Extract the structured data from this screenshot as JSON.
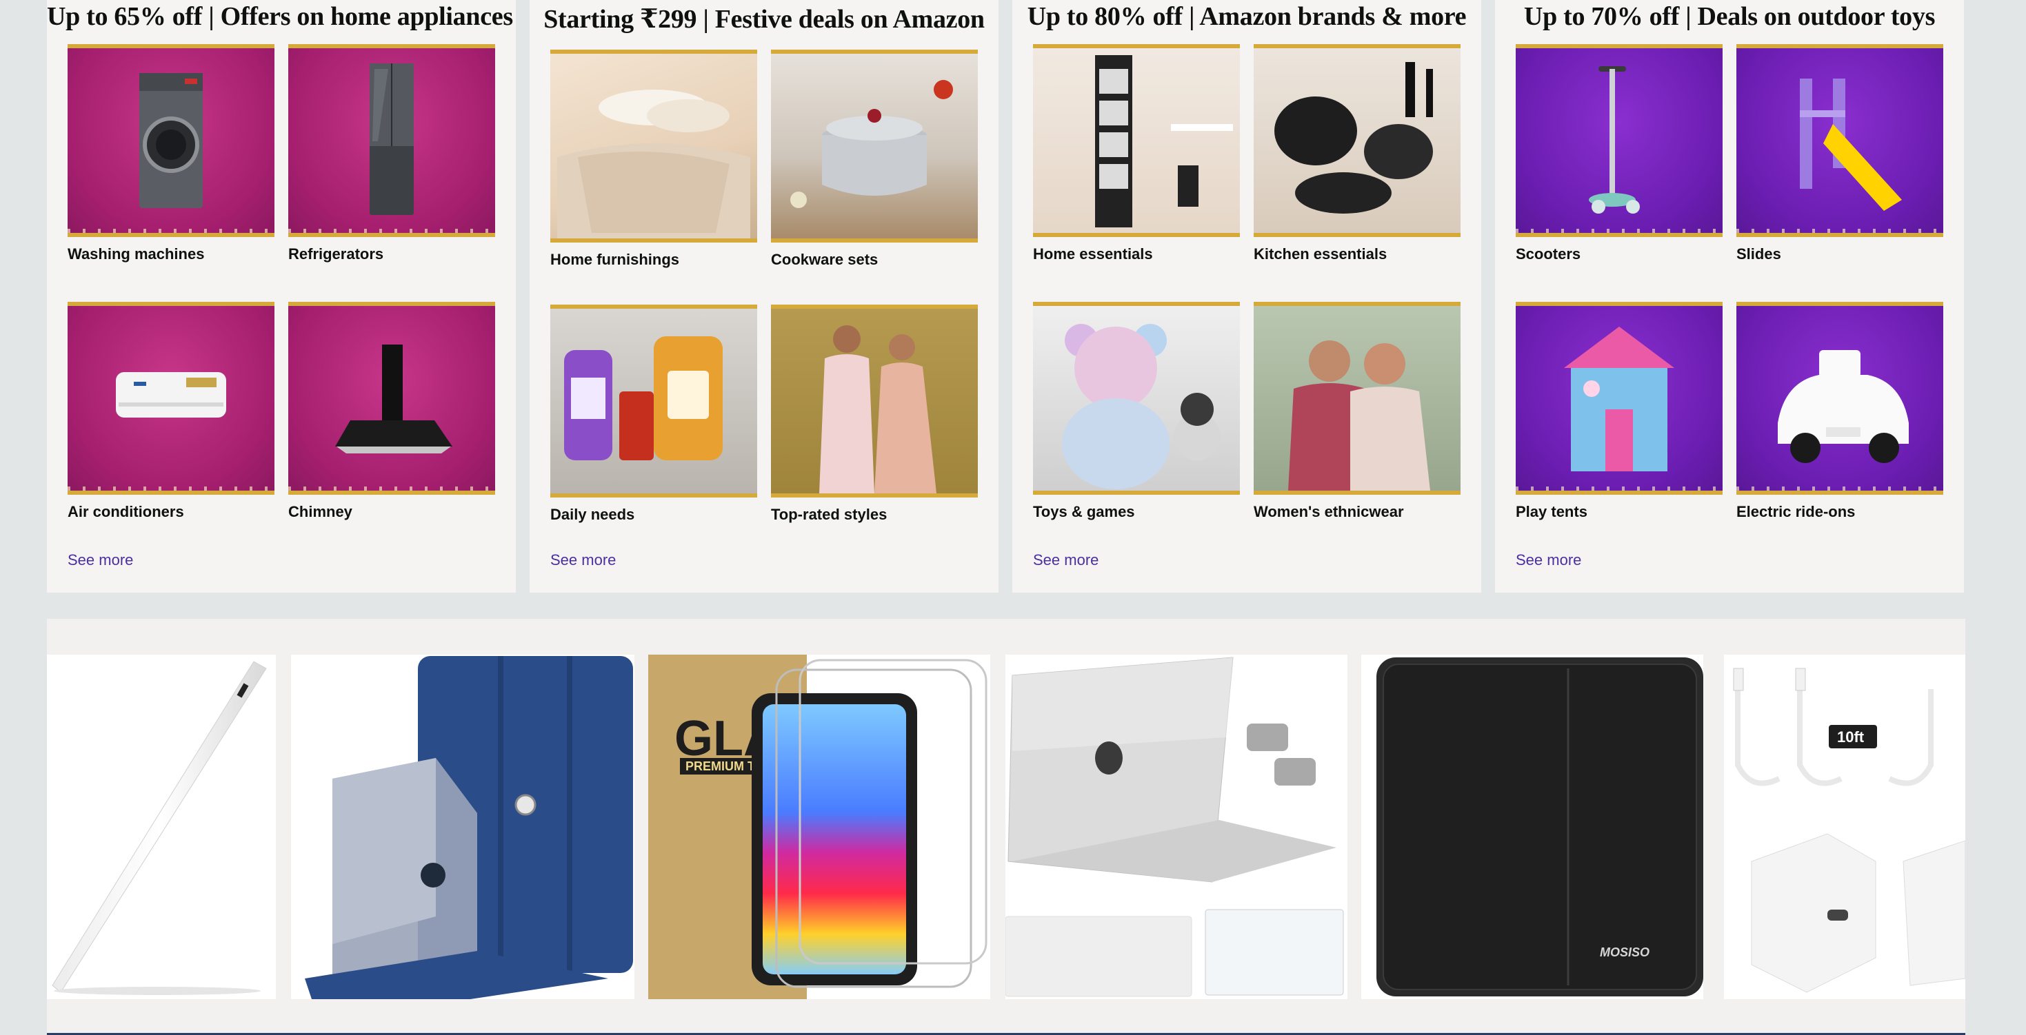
{
  "cards": [
    {
      "title": "Up to 65% off | Offers on home appliances",
      "tiles": [
        {
          "label": "Washing machines",
          "icon": "washing-machine"
        },
        {
          "label": "Refrigerators",
          "icon": "refrigerator"
        },
        {
          "label": "Air conditioners",
          "icon": "air-conditioner"
        },
        {
          "label": "Chimney",
          "icon": "chimney"
        }
      ],
      "see_more": "See more",
      "theme_color": "#a51f6e"
    },
    {
      "title": "Starting ₹299 | Festive deals on Amazon",
      "tiles": [
        {
          "label": "Home furnishings",
          "icon": "bedding"
        },
        {
          "label": "Cookware sets",
          "icon": "cooking-pot"
        },
        {
          "label": "Daily needs",
          "icon": "grocery-bottles"
        },
        {
          "label": "Top-rated styles",
          "icon": "couple-ethnic-wear"
        }
      ],
      "see_more": "See more"
    },
    {
      "title": "Up to 80% off | Amazon brands & more",
      "tiles": [
        {
          "label": "Home essentials",
          "icon": "storage-rack"
        },
        {
          "label": "Kitchen essentials",
          "icon": "kitchen-utensils"
        },
        {
          "label": "Toys & games",
          "icon": "teddy-bear"
        },
        {
          "label": "Women's ethnicwear",
          "icon": "women-ethnicwear"
        }
      ],
      "see_more": "See more"
    },
    {
      "title": "Up to 70% off | Deals on outdoor toys",
      "tiles": [
        {
          "label": "Scooters",
          "icon": "kick-scooter"
        },
        {
          "label": "Slides",
          "icon": "slide"
        },
        {
          "label": "Play tents",
          "icon": "play-tent"
        },
        {
          "label": "Electric ride-ons",
          "icon": "toy-car"
        }
      ],
      "see_more": "See more",
      "theme_color": "#6a1db0"
    }
  ],
  "products": [
    {
      "name": "stylus-pencil"
    },
    {
      "name": "ipad-folio-case"
    },
    {
      "name": "glass-screen-protector",
      "text": "GLAS",
      "subtext": "PREMIUM T"
    },
    {
      "name": "macbook-hard-case"
    },
    {
      "name": "laptop-sleeve",
      "brand": "MOSISO"
    },
    {
      "name": "usb-c-cable-charger",
      "badge": "10ft"
    }
  ],
  "colors": {
    "page_bg": "#e3e6e6",
    "card_bg": "#f5f4f3",
    "link": "#4b2fa0",
    "gold_border": "#d6aa3a"
  }
}
